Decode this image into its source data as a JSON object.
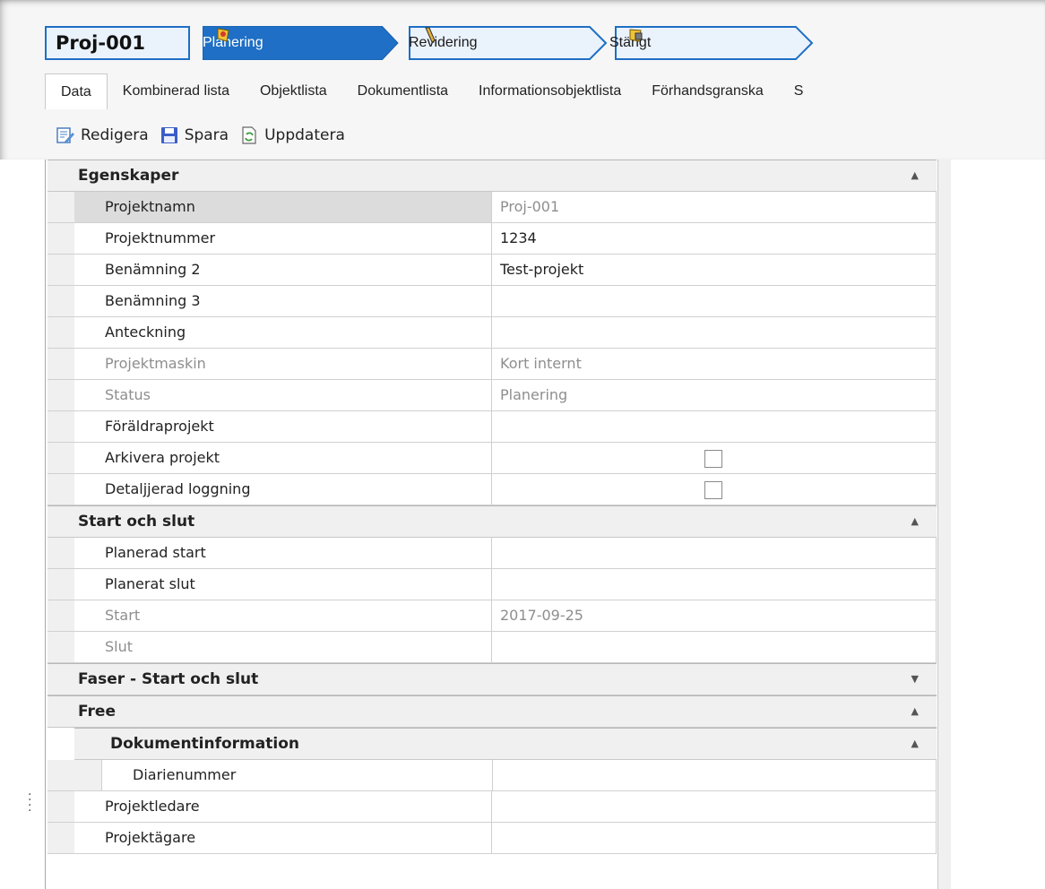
{
  "project_id": "Proj-001",
  "workflow": [
    {
      "label": "Planering",
      "icon": "flag-shield-icon",
      "active": true
    },
    {
      "label": "Revidering",
      "icon": "pencil-icon",
      "active": false
    },
    {
      "label": "Stängt",
      "icon": "lock-shield-icon",
      "active": false
    }
  ],
  "tabs": [
    "Data",
    "Kombinerad lista",
    "Objektlista",
    "Dokumentlista",
    "Informationsobjektlista",
    "Förhandsgranska",
    "S"
  ],
  "toolbar": {
    "edit_label": "Redigera",
    "save_label": "Spara",
    "refresh_label": "Uppdatera"
  },
  "grid": {
    "egenskaper": {
      "title": "Egenskaper",
      "rows": [
        {
          "name": "Projektnamn",
          "value": "Proj-001"
        },
        {
          "name": "Projektnummer",
          "value": "1234"
        },
        {
          "name": "Benämning 2",
          "value": "Test-projekt"
        },
        {
          "name": "Benämning 3",
          "value": ""
        },
        {
          "name": "Anteckning",
          "value": ""
        },
        {
          "name": "Projektmaskin",
          "value": "Kort internt"
        },
        {
          "name": "Status",
          "value": "Planering"
        },
        {
          "name": "Föräldraprojekt",
          "value": ""
        },
        {
          "name": "Arkivera projekt",
          "checked": false
        },
        {
          "name": "Detaljjerad loggning",
          "checked": false
        }
      ]
    },
    "start_slut": {
      "title": "Start och slut",
      "rows": [
        {
          "name": "Planerad start",
          "value": ""
        },
        {
          "name": "Planerat slut",
          "value": ""
        },
        {
          "name": "Start",
          "value": "2017-09-25"
        },
        {
          "name": "Slut",
          "value": ""
        }
      ]
    },
    "faser": {
      "title": "Faser - Start och slut"
    },
    "free": {
      "title": "Free",
      "dokumentinformation": {
        "title": "Dokumentinformation",
        "rows": [
          {
            "name": "Diarienummer",
            "value": ""
          }
        ]
      },
      "rows": [
        {
          "name": "Projektledare",
          "value": ""
        },
        {
          "name": "Projektägare",
          "value": ""
        }
      ]
    }
  },
  "colors": {
    "accent": "#1e6fc5",
    "step_bg": "#eaf2fb"
  }
}
